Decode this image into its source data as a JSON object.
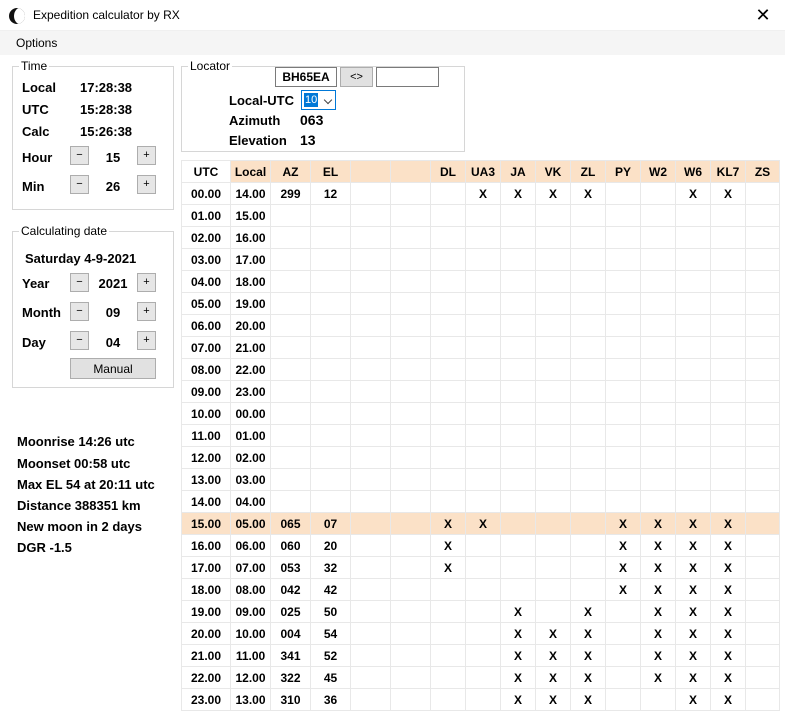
{
  "window": {
    "title": "Expedition calculator by RX",
    "close": "✕"
  },
  "menu": {
    "options": "Options"
  },
  "time": {
    "legend": "Time",
    "local_label": "Local",
    "local_value": "17:28:38",
    "utc_label": "UTC",
    "utc_value": "15:28:38",
    "calc_label": "Calc",
    "calc_value": "15:26:38",
    "hour_label": "Hour",
    "hour_value": "15",
    "min_label": "Min",
    "min_value": "26",
    "minus": "−",
    "plus": "+"
  },
  "date": {
    "legend": "Calculating date",
    "display": "Saturday 4-9-2021",
    "year_label": "Year",
    "year_value": "2021",
    "month_label": "Month",
    "month_value": "09",
    "day_label": "Day",
    "day_value": "04",
    "manual_label": "Manual"
  },
  "locator": {
    "legend": "Locator",
    "value": "BH65EA",
    "swap_label": "<>",
    "target_value": "",
    "local_utc_label": "Local-UTC",
    "local_utc_value": "10",
    "azimuth_label": "Azimuth",
    "azimuth_value": "063",
    "elevation_label": "Elevation",
    "elevation_value": "13"
  },
  "moon": {
    "moonrise": "Moonrise 14:26 utc",
    "moonset": "Moonset 00:58 utc",
    "max_el": "Max EL 54 at 20:11 utc",
    "distance": "Distance 388351 km",
    "new_moon": "New moon in 2 days",
    "dgr": "DGR -1.5"
  },
  "table": {
    "columns": [
      "UTC",
      "Local",
      "AZ",
      "EL",
      "",
      "",
      "DL",
      "UA3",
      "JA",
      "VK",
      "ZL",
      "PY",
      "W2",
      "W6",
      "KL7",
      "ZS"
    ],
    "highlight_row": "15.00",
    "rows": [
      [
        "00.00",
        "14.00",
        "299",
        "12",
        "",
        "",
        "",
        "X",
        "X",
        "X",
        "X",
        "",
        "",
        "X",
        "X",
        ""
      ],
      [
        "01.00",
        "15.00",
        "",
        "",
        "",
        "",
        "",
        "",
        "",
        "",
        "",
        "",
        "",
        "",
        "",
        ""
      ],
      [
        "02.00",
        "16.00",
        "",
        "",
        "",
        "",
        "",
        "",
        "",
        "",
        "",
        "",
        "",
        "",
        "",
        ""
      ],
      [
        "03.00",
        "17.00",
        "",
        "",
        "",
        "",
        "",
        "",
        "",
        "",
        "",
        "",
        "",
        "",
        "",
        ""
      ],
      [
        "04.00",
        "18.00",
        "",
        "",
        "",
        "",
        "",
        "",
        "",
        "",
        "",
        "",
        "",
        "",
        "",
        ""
      ],
      [
        "05.00",
        "19.00",
        "",
        "",
        "",
        "",
        "",
        "",
        "",
        "",
        "",
        "",
        "",
        "",
        "",
        ""
      ],
      [
        "06.00",
        "20.00",
        "",
        "",
        "",
        "",
        "",
        "",
        "",
        "",
        "",
        "",
        "",
        "",
        "",
        ""
      ],
      [
        "07.00",
        "21.00",
        "",
        "",
        "",
        "",
        "",
        "",
        "",
        "",
        "",
        "",
        "",
        "",
        "",
        ""
      ],
      [
        "08.00",
        "22.00",
        "",
        "",
        "",
        "",
        "",
        "",
        "",
        "",
        "",
        "",
        "",
        "",
        "",
        ""
      ],
      [
        "09.00",
        "23.00",
        "",
        "",
        "",
        "",
        "",
        "",
        "",
        "",
        "",
        "",
        "",
        "",
        "",
        ""
      ],
      [
        "10.00",
        "00.00",
        "",
        "",
        "",
        "",
        "",
        "",
        "",
        "",
        "",
        "",
        "",
        "",
        "",
        ""
      ],
      [
        "11.00",
        "01.00",
        "",
        "",
        "",
        "",
        "",
        "",
        "",
        "",
        "",
        "",
        "",
        "",
        "",
        ""
      ],
      [
        "12.00",
        "02.00",
        "",
        "",
        "",
        "",
        "",
        "",
        "",
        "",
        "",
        "",
        "",
        "",
        "",
        ""
      ],
      [
        "13.00",
        "03.00",
        "",
        "",
        "",
        "",
        "",
        "",
        "",
        "",
        "",
        "",
        "",
        "",
        "",
        ""
      ],
      [
        "14.00",
        "04.00",
        "",
        "",
        "",
        "",
        "",
        "",
        "",
        "",
        "",
        "",
        "",
        "",
        "",
        ""
      ],
      [
        "15.00",
        "05.00",
        "065",
        "07",
        "",
        "",
        "X",
        "X",
        "",
        "",
        "",
        "X",
        "X",
        "X",
        "X",
        ""
      ],
      [
        "16.00",
        "06.00",
        "060",
        "20",
        "",
        "",
        "X",
        "",
        "",
        "",
        "",
        "X",
        "X",
        "X",
        "X",
        ""
      ],
      [
        "17.00",
        "07.00",
        "053",
        "32",
        "",
        "",
        "X",
        "",
        "",
        "",
        "",
        "X",
        "X",
        "X",
        "X",
        ""
      ],
      [
        "18.00",
        "08.00",
        "042",
        "42",
        "",
        "",
        "",
        "",
        "",
        "",
        "",
        "X",
        "X",
        "X",
        "X",
        ""
      ],
      [
        "19.00",
        "09.00",
        "025",
        "50",
        "",
        "",
        "",
        "",
        "X",
        "",
        "X",
        "",
        "X",
        "X",
        "X",
        ""
      ],
      [
        "20.00",
        "10.00",
        "004",
        "54",
        "",
        "",
        "",
        "",
        "X",
        "X",
        "X",
        "",
        "X",
        "X",
        "X",
        ""
      ],
      [
        "21.00",
        "11.00",
        "341",
        "52",
        "",
        "",
        "",
        "",
        "X",
        "X",
        "X",
        "",
        "X",
        "X",
        "X",
        ""
      ],
      [
        "22.00",
        "12.00",
        "322",
        "45",
        "",
        "",
        "",
        "",
        "X",
        "X",
        "X",
        "",
        "X",
        "X",
        "X",
        ""
      ],
      [
        "23.00",
        "13.00",
        "310",
        "36",
        "",
        "",
        "",
        "",
        "X",
        "X",
        "X",
        "",
        "",
        "X",
        "X",
        ""
      ]
    ]
  }
}
